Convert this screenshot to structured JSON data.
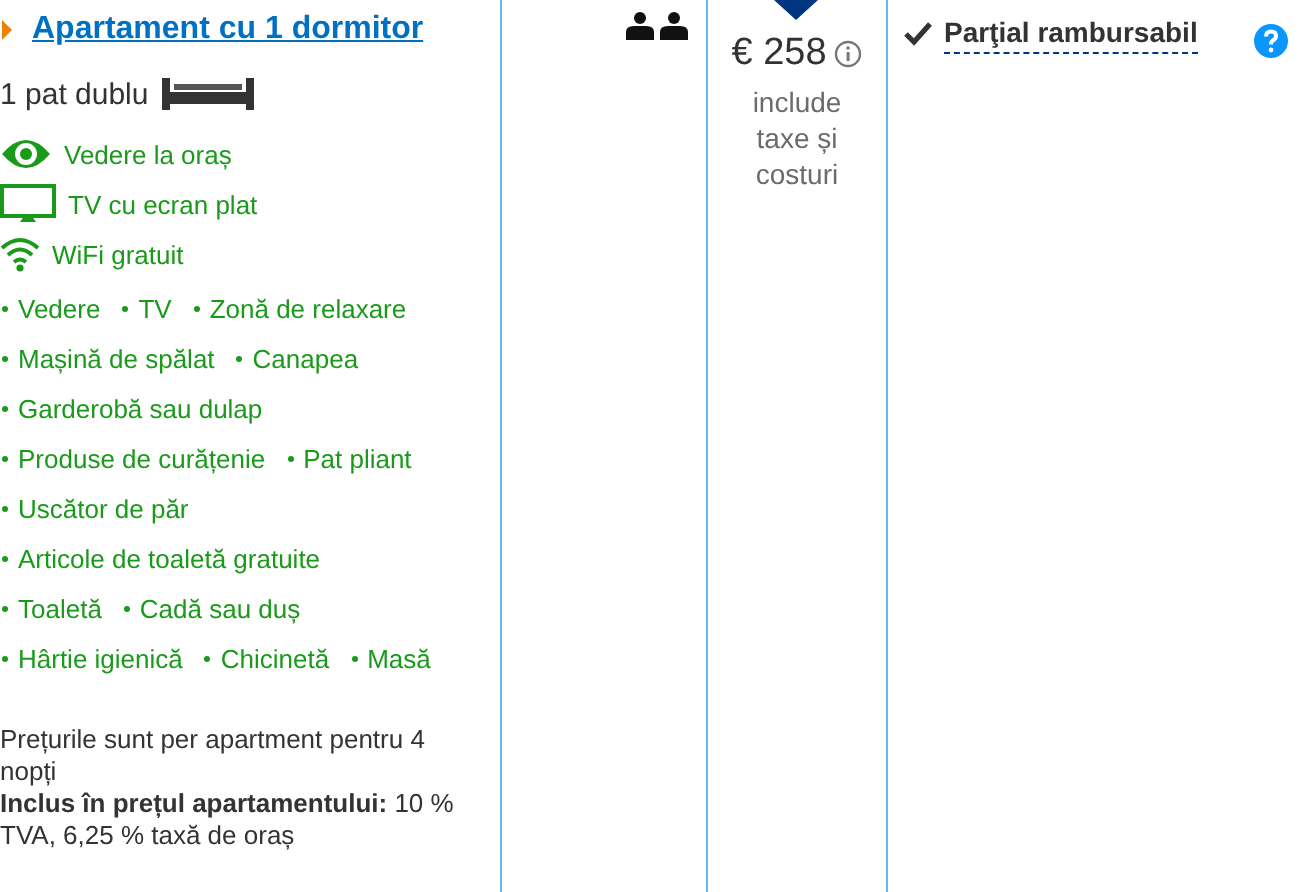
{
  "room": {
    "title": "Apartament cu 1 dormitor",
    "bed": "1 pat dublu",
    "highlights": [
      {
        "kind": "eye",
        "label": "Vedere la oraș"
      },
      {
        "kind": "tv",
        "label": "TV cu ecran plat"
      },
      {
        "kind": "wifi",
        "label": "WiFi gratuit"
      }
    ],
    "facility_rows": [
      [
        "Vedere",
        "TV",
        "Zonă de relaxare"
      ],
      [
        "Mașină de spălat",
        "Canapea"
      ],
      [
        "Garderobă sau dulap"
      ],
      [
        "Produse de curățenie",
        "Pat pliant"
      ],
      [
        "Uscător de păr"
      ],
      [
        "Articole de toaletă gratuite"
      ],
      [
        "Toaletă",
        "Cadă sau duș"
      ],
      [
        "Hârtie igienică",
        "Chicinetă",
        "Masă"
      ]
    ],
    "price_note": "Prețurile sunt per apartment pentru 4 nopți",
    "included": "**Inclus în prețul apartamentului:** 10 % TVA, 6,25 % taxă de oraș"
  },
  "price": {
    "amount": "€ 258",
    "note": "include taxe și costuri"
  },
  "policy": {
    "label": "Parţial rambursabil"
  }
}
